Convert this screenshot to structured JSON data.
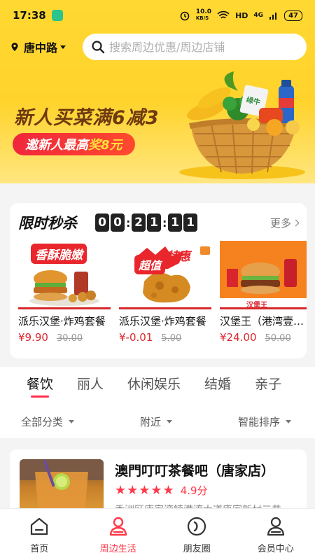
{
  "status": {
    "time": "17:38",
    "net_speed": "10.0",
    "net_unit": "KB/S",
    "hd": "HD",
    "signal": "4G",
    "battery": "47"
  },
  "location": {
    "name": "唐中路"
  },
  "search": {
    "placeholder": "搜索周边优惠/周边店铺"
  },
  "banner": {
    "title": "新人买菜满6减3",
    "pill_prefix": "邀新人最高",
    "pill_highlight": "奖8元",
    "box_label": "绿牛"
  },
  "flash": {
    "title": "限时秒杀",
    "countdown": [
      "0",
      "0",
      "2",
      "1",
      "1",
      "1"
    ],
    "more": "更多",
    "products": [
      {
        "name": "派乐汉堡·炸鸡套餐",
        "price": "¥9.90",
        "orig": "30.00",
        "tag": "香酥脆嫩"
      },
      {
        "name": "派乐汉堡·炸鸡套餐",
        "price": "¥-0.01",
        "orig": "5.00",
        "tag_a": "超值",
        "tag_b": "特惠"
      },
      {
        "name": "汉堡王（港湾壹号店）",
        "price": "¥24.00",
        "orig": "50.00",
        "brand": "汉堡王"
      }
    ]
  },
  "categories": {
    "tabs": [
      "餐饮",
      "丽人",
      "休闲娱乐",
      "结婚",
      "亲子"
    ],
    "filters": [
      "全部分类",
      "附近",
      "智能排序"
    ]
  },
  "store": {
    "name": "澳門叮叮茶餐吧（唐家店）",
    "stars": "★★★★★",
    "score": "4.9分",
    "addr": "香洲区唐家湾镇港湾大道唐家新村三巷"
  },
  "nav": [
    {
      "label": "首页"
    },
    {
      "label": "周边生活"
    },
    {
      "label": "朋友圈"
    },
    {
      "label": "会员中心"
    }
  ],
  "colors": {
    "accent": "#ff3a4a",
    "banner": "#ffd832",
    "price": "#e0262e"
  }
}
